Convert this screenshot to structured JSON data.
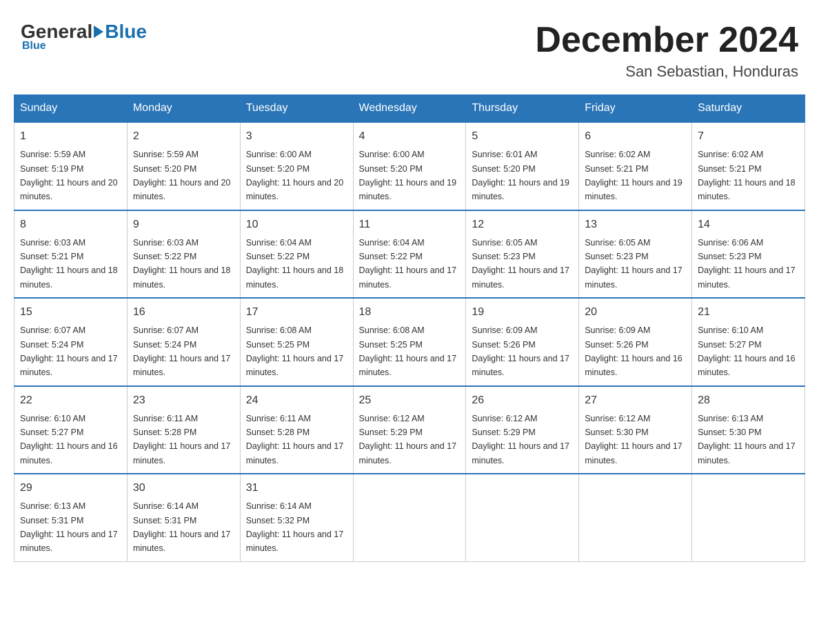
{
  "header": {
    "logo": {
      "general": "General",
      "blue": "Blue"
    },
    "month_title": "December 2024",
    "location": "San Sebastian, Honduras"
  },
  "weekdays": [
    "Sunday",
    "Monday",
    "Tuesday",
    "Wednesday",
    "Thursday",
    "Friday",
    "Saturday"
  ],
  "weeks": [
    [
      {
        "day": "1",
        "sunrise": "5:59 AM",
        "sunset": "5:19 PM",
        "daylight": "11 hours and 20 minutes."
      },
      {
        "day": "2",
        "sunrise": "5:59 AM",
        "sunset": "5:20 PM",
        "daylight": "11 hours and 20 minutes."
      },
      {
        "day": "3",
        "sunrise": "6:00 AM",
        "sunset": "5:20 PM",
        "daylight": "11 hours and 20 minutes."
      },
      {
        "day": "4",
        "sunrise": "6:00 AM",
        "sunset": "5:20 PM",
        "daylight": "11 hours and 19 minutes."
      },
      {
        "day": "5",
        "sunrise": "6:01 AM",
        "sunset": "5:20 PM",
        "daylight": "11 hours and 19 minutes."
      },
      {
        "day": "6",
        "sunrise": "6:02 AM",
        "sunset": "5:21 PM",
        "daylight": "11 hours and 19 minutes."
      },
      {
        "day": "7",
        "sunrise": "6:02 AM",
        "sunset": "5:21 PM",
        "daylight": "11 hours and 18 minutes."
      }
    ],
    [
      {
        "day": "8",
        "sunrise": "6:03 AM",
        "sunset": "5:21 PM",
        "daylight": "11 hours and 18 minutes."
      },
      {
        "day": "9",
        "sunrise": "6:03 AM",
        "sunset": "5:22 PM",
        "daylight": "11 hours and 18 minutes."
      },
      {
        "day": "10",
        "sunrise": "6:04 AM",
        "sunset": "5:22 PM",
        "daylight": "11 hours and 18 minutes."
      },
      {
        "day": "11",
        "sunrise": "6:04 AM",
        "sunset": "5:22 PM",
        "daylight": "11 hours and 17 minutes."
      },
      {
        "day": "12",
        "sunrise": "6:05 AM",
        "sunset": "5:23 PM",
        "daylight": "11 hours and 17 minutes."
      },
      {
        "day": "13",
        "sunrise": "6:05 AM",
        "sunset": "5:23 PM",
        "daylight": "11 hours and 17 minutes."
      },
      {
        "day": "14",
        "sunrise": "6:06 AM",
        "sunset": "5:23 PM",
        "daylight": "11 hours and 17 minutes."
      }
    ],
    [
      {
        "day": "15",
        "sunrise": "6:07 AM",
        "sunset": "5:24 PM",
        "daylight": "11 hours and 17 minutes."
      },
      {
        "day": "16",
        "sunrise": "6:07 AM",
        "sunset": "5:24 PM",
        "daylight": "11 hours and 17 minutes."
      },
      {
        "day": "17",
        "sunrise": "6:08 AM",
        "sunset": "5:25 PM",
        "daylight": "11 hours and 17 minutes."
      },
      {
        "day": "18",
        "sunrise": "6:08 AM",
        "sunset": "5:25 PM",
        "daylight": "11 hours and 17 minutes."
      },
      {
        "day": "19",
        "sunrise": "6:09 AM",
        "sunset": "5:26 PM",
        "daylight": "11 hours and 17 minutes."
      },
      {
        "day": "20",
        "sunrise": "6:09 AM",
        "sunset": "5:26 PM",
        "daylight": "11 hours and 16 minutes."
      },
      {
        "day": "21",
        "sunrise": "6:10 AM",
        "sunset": "5:27 PM",
        "daylight": "11 hours and 16 minutes."
      }
    ],
    [
      {
        "day": "22",
        "sunrise": "6:10 AM",
        "sunset": "5:27 PM",
        "daylight": "11 hours and 16 minutes."
      },
      {
        "day": "23",
        "sunrise": "6:11 AM",
        "sunset": "5:28 PM",
        "daylight": "11 hours and 17 minutes."
      },
      {
        "day": "24",
        "sunrise": "6:11 AM",
        "sunset": "5:28 PM",
        "daylight": "11 hours and 17 minutes."
      },
      {
        "day": "25",
        "sunrise": "6:12 AM",
        "sunset": "5:29 PM",
        "daylight": "11 hours and 17 minutes."
      },
      {
        "day": "26",
        "sunrise": "6:12 AM",
        "sunset": "5:29 PM",
        "daylight": "11 hours and 17 minutes."
      },
      {
        "day": "27",
        "sunrise": "6:12 AM",
        "sunset": "5:30 PM",
        "daylight": "11 hours and 17 minutes."
      },
      {
        "day": "28",
        "sunrise": "6:13 AM",
        "sunset": "5:30 PM",
        "daylight": "11 hours and 17 minutes."
      }
    ],
    [
      {
        "day": "29",
        "sunrise": "6:13 AM",
        "sunset": "5:31 PM",
        "daylight": "11 hours and 17 minutes."
      },
      {
        "day": "30",
        "sunrise": "6:14 AM",
        "sunset": "5:31 PM",
        "daylight": "11 hours and 17 minutes."
      },
      {
        "day": "31",
        "sunrise": "6:14 AM",
        "sunset": "5:32 PM",
        "daylight": "11 hours and 17 minutes."
      },
      null,
      null,
      null,
      null
    ]
  ]
}
